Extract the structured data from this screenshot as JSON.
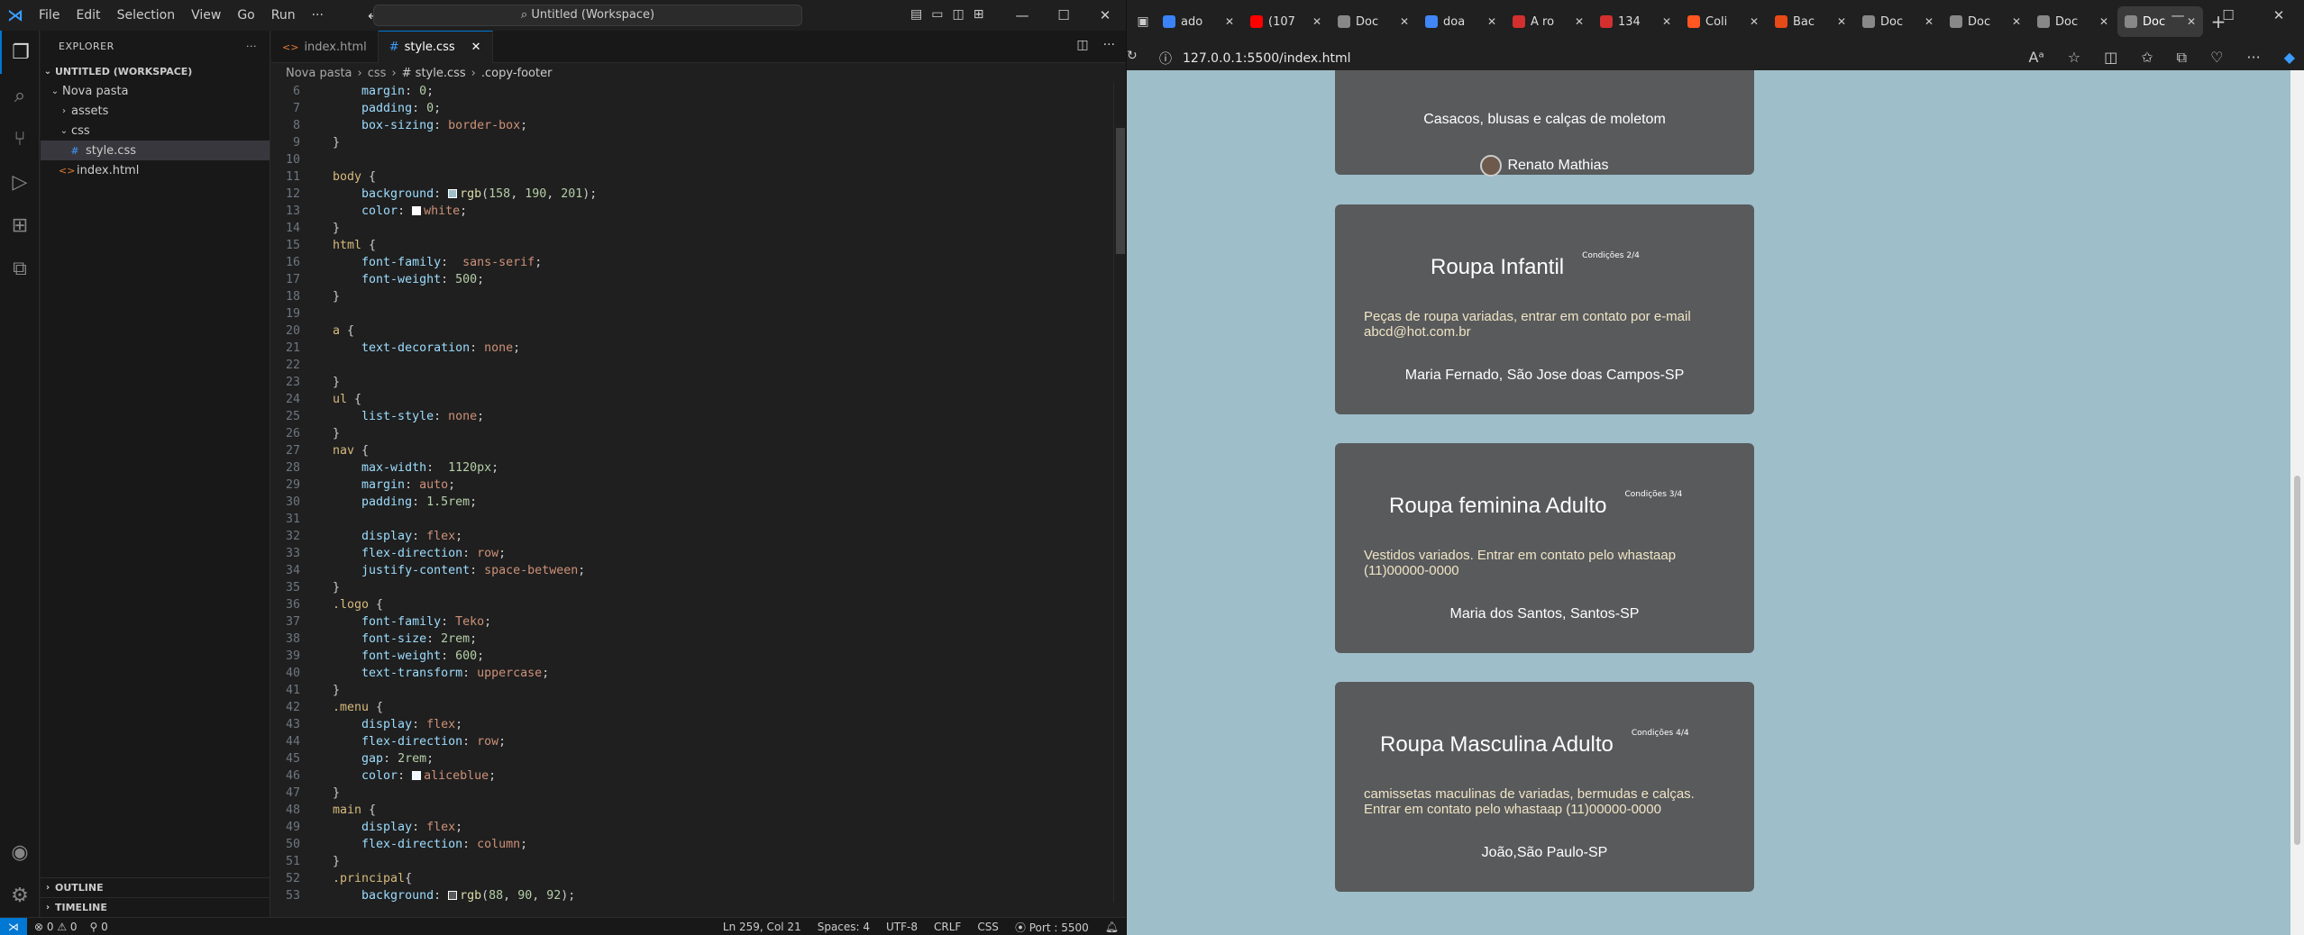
{
  "vscode": {
    "menu": [
      "File",
      "Edit",
      "Selection",
      "View",
      "Go",
      "Run",
      "···"
    ],
    "command_center": "Untitled (Workspace)",
    "explorer": {
      "title": "EXPLORER",
      "workspace": "UNTITLED (WORKSPACE)",
      "folder": "Nova pasta",
      "items": [
        {
          "label": "assets",
          "type": "folder"
        },
        {
          "label": "css",
          "type": "folder"
        },
        {
          "label": "style.css",
          "type": "file"
        },
        {
          "label": "index.html",
          "type": "file"
        }
      ],
      "outline": "OUTLINE",
      "timeline": "TIMELINE"
    },
    "tabs": [
      {
        "label": "index.html",
        "active": false
      },
      {
        "label": "style.css",
        "active": true
      }
    ],
    "breadcrumb": [
      "Nova pasta",
      "css",
      "# style.css",
      ".copy-footer"
    ],
    "code_lines": [
      {
        "n": "6",
        "html": "    <span class='t-prop'>margin</span>: <span class='t-num'>0</span>;"
      },
      {
        "n": "7",
        "html": "    <span class='t-prop'>padding</span>: <span class='t-num'>0</span>;"
      },
      {
        "n": "8",
        "html": "    <span class='t-prop'>box-sizing</span>: <span class='t-val'>border-box</span>;"
      },
      {
        "n": "9",
        "html": "}"
      },
      {
        "n": "10",
        "html": ""
      },
      {
        "n": "11",
        "html": "<span class='t-sel'>body</span> {"
      },
      {
        "n": "12",
        "html": "    <span class='t-prop'>background</span>: <span class='swatch' style='background:rgb(158,190,201)'></span><span class='t-fn'>rgb</span>(<span class='t-num'>158</span>, <span class='t-num'>190</span>, <span class='t-num'>201</span>);"
      },
      {
        "n": "13",
        "html": "    <span class='t-prop'>color</span>: <span class='swatch' style='background:#fff'></span><span class='t-val'>white</span>;"
      },
      {
        "n": "14",
        "html": "}"
      },
      {
        "n": "15",
        "html": "<span class='t-sel'>html</span> {"
      },
      {
        "n": "16",
        "html": "    <span class='t-prop'>font-family</span>:  <span class='t-val'>sans-serif</span>;"
      },
      {
        "n": "17",
        "html": "    <span class='t-prop'>font-weight</span>: <span class='t-num'>500</span>;"
      },
      {
        "n": "18",
        "html": "}"
      },
      {
        "n": "19",
        "html": ""
      },
      {
        "n": "20",
        "html": "<span class='t-sel'>a</span> {"
      },
      {
        "n": "21",
        "html": "    <span class='t-prop'>text-decoration</span>: <span class='t-val'>none</span>;"
      },
      {
        "n": "22",
        "html": ""
      },
      {
        "n": "23",
        "html": "}"
      },
      {
        "n": "24",
        "html": "<span class='t-sel'>ul</span> {"
      },
      {
        "n": "25",
        "html": "    <span class='t-prop'>list-style</span>: <span class='t-val'>none</span>;"
      },
      {
        "n": "26",
        "html": "}"
      },
      {
        "n": "27",
        "html": "<span class='t-sel'>nav</span> {"
      },
      {
        "n": "28",
        "html": "    <span class='t-prop'>max-width</span>:  <span class='t-num'>1120px</span>;"
      },
      {
        "n": "29",
        "html": "    <span class='t-prop'>margin</span>: <span class='t-val'>auto</span>;"
      },
      {
        "n": "30",
        "html": "    <span class='t-prop'>padding</span>: <span class='t-num'>1.5rem</span>;"
      },
      {
        "n": "31",
        "html": ""
      },
      {
        "n": "32",
        "html": "    <span class='t-prop'>display</span>: <span class='t-val'>flex</span>;"
      },
      {
        "n": "33",
        "html": "    <span class='t-prop'>flex-direction</span>: <span class='t-val'>row</span>;"
      },
      {
        "n": "34",
        "html": "    <span class='t-prop'>justify-content</span>: <span class='t-val'>space-between</span>;"
      },
      {
        "n": "35",
        "html": "}"
      },
      {
        "n": "36",
        "html": "<span class='t-sel'>.logo</span> {"
      },
      {
        "n": "37",
        "html": "    <span class='t-prop'>font-family</span>: <span class='t-val'>Teko</span>;"
      },
      {
        "n": "38",
        "html": "    <span class='t-prop'>font-size</span>: <span class='t-num'>2rem</span>;"
      },
      {
        "n": "39",
        "html": "    <span class='t-prop'>font-weight</span>: <span class='t-num'>600</span>;"
      },
      {
        "n": "40",
        "html": "    <span class='t-prop'>text-transform</span>: <span class='t-val'>uppercase</span>;"
      },
      {
        "n": "41",
        "html": "}"
      },
      {
        "n": "42",
        "html": "<span class='t-sel'>.menu</span> {"
      },
      {
        "n": "43",
        "html": "    <span class='t-prop'>display</span>: <span class='t-val'>flex</span>;"
      },
      {
        "n": "44",
        "html": "    <span class='t-prop'>flex-direction</span>: <span class='t-val'>row</span>;"
      },
      {
        "n": "45",
        "html": "    <span class='t-prop'>gap</span>: <span class='t-num'>2rem</span>;"
      },
      {
        "n": "46",
        "html": "    <span class='t-prop'>color</span>: <span class='swatch' style='background:aliceblue'></span><span class='t-val'>aliceblue</span>;"
      },
      {
        "n": "47",
        "html": "}"
      },
      {
        "n": "48",
        "html": "<span class='t-sel'>main</span> {"
      },
      {
        "n": "49",
        "html": "    <span class='t-prop'>display</span>: <span class='t-val'>flex</span>;"
      },
      {
        "n": "50",
        "html": "    <span class='t-prop'>flex-direction</span>: <span class='t-val'>column</span>;"
      },
      {
        "n": "51",
        "html": "}"
      },
      {
        "n": "52",
        "html": "<span class='t-sel'>.principal</span>{"
      },
      {
        "n": "53",
        "html": "    <span class='t-prop'>background</span>: <span class='swatch' style='background:rgb(88,90,92)'></span><span class='t-fn'>rgb</span>(<span class='t-num'>88</span>, <span class='t-num'>90</span>, <span class='t-num'>92</span>);"
      },
      {
        "n": "54",
        "html": ""
      }
    ],
    "status": {
      "errors": "⊗ 0 ⚠ 0",
      "ports": "⚲ 0",
      "position": "Ln 259, Col 21",
      "spaces": "Spaces: 4",
      "encoding": "UTF-8",
      "eol": "CRLF",
      "language": "CSS",
      "port": "⦿ Port : 5500"
    }
  },
  "browser": {
    "tabs": [
      {
        "label": "ado",
        "color": "#3b82f6"
      },
      {
        "label": "(107",
        "color": "#ff0000"
      },
      {
        "label": "Doc",
        "color": "#888"
      },
      {
        "label": "doa",
        "color": "#4285f4"
      },
      {
        "label": "A ro",
        "color": "#d32f2f"
      },
      {
        "label": "134",
        "color": "#d32f2f"
      },
      {
        "label": "Coli",
        "color": "#ff5722"
      },
      {
        "label": "Bac",
        "color": "#e64a19"
      },
      {
        "label": "Doc",
        "color": "#888"
      },
      {
        "label": "Doc",
        "color": "#888"
      },
      {
        "label": "Doc",
        "color": "#888"
      },
      {
        "label": "Doc",
        "color": "#888"
      }
    ],
    "url": "127.0.0.1:5500/index.html",
    "cards": [
      {
        "desc": "Casacos, blusas e calças de moletom",
        "author": "Renato Mathias",
        "has_avatar": true
      },
      {
        "title": "Roupa Infantil",
        "condition": "Condições 2/4",
        "desc": "Peças de roupa variadas, entrar em contato por e-mail abcd@hot.com.br",
        "author": "Maria Fernado, São Jose doas Campos-SP"
      },
      {
        "title": "Roupa feminina Adulto",
        "condition": "Condições 3/4",
        "desc": "Vestidos variados. Entrar em contato pelo whastaap (11)00000-0000",
        "author": "Maria dos Santos, Santos-SP"
      },
      {
        "title": "Roupa Masculina Adulto",
        "condition": "Condições 4/4",
        "desc": "camissetas maculinas de variadas, bermudas e calças. Entrar em contato pelo whastaap (11)00000-0000",
        "author": "João,São Paulo-SP"
      }
    ]
  }
}
